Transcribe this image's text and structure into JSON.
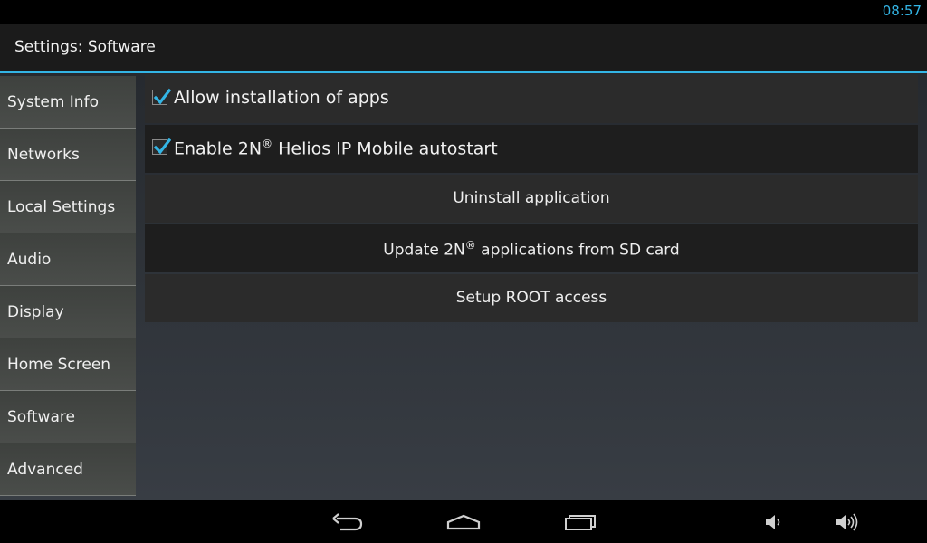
{
  "status_bar": {
    "time": "08:57"
  },
  "action_bar": {
    "title": "Settings: Software"
  },
  "sidebar": {
    "items": [
      {
        "label": "System Info"
      },
      {
        "label": "Networks"
      },
      {
        "label": "Local Settings"
      },
      {
        "label": "Audio"
      },
      {
        "label": "Display"
      },
      {
        "label": "Home Screen"
      },
      {
        "label": "Software"
      },
      {
        "label": "Advanced"
      }
    ]
  },
  "settings": {
    "allow_install": {
      "label": "Allow installation of apps",
      "checked": true
    },
    "autostart": {
      "label_pre": "Enable 2N",
      "sup": "®",
      "label_post": " Helios IP Mobile autostart",
      "checked": true
    },
    "uninstall": {
      "label": "Uninstall application"
    },
    "update": {
      "label_pre": "Update 2N",
      "sup": "®",
      "label_post": " applications from SD card"
    },
    "root": {
      "label": "Setup ROOT access"
    }
  },
  "nav_bar": {
    "icons": [
      "back-icon",
      "home-icon",
      "recent-apps-icon",
      "volume-down-icon",
      "volume-up-icon"
    ]
  },
  "colors": {
    "accent": "#33b5e5",
    "checkmark": "#33b5e5"
  }
}
